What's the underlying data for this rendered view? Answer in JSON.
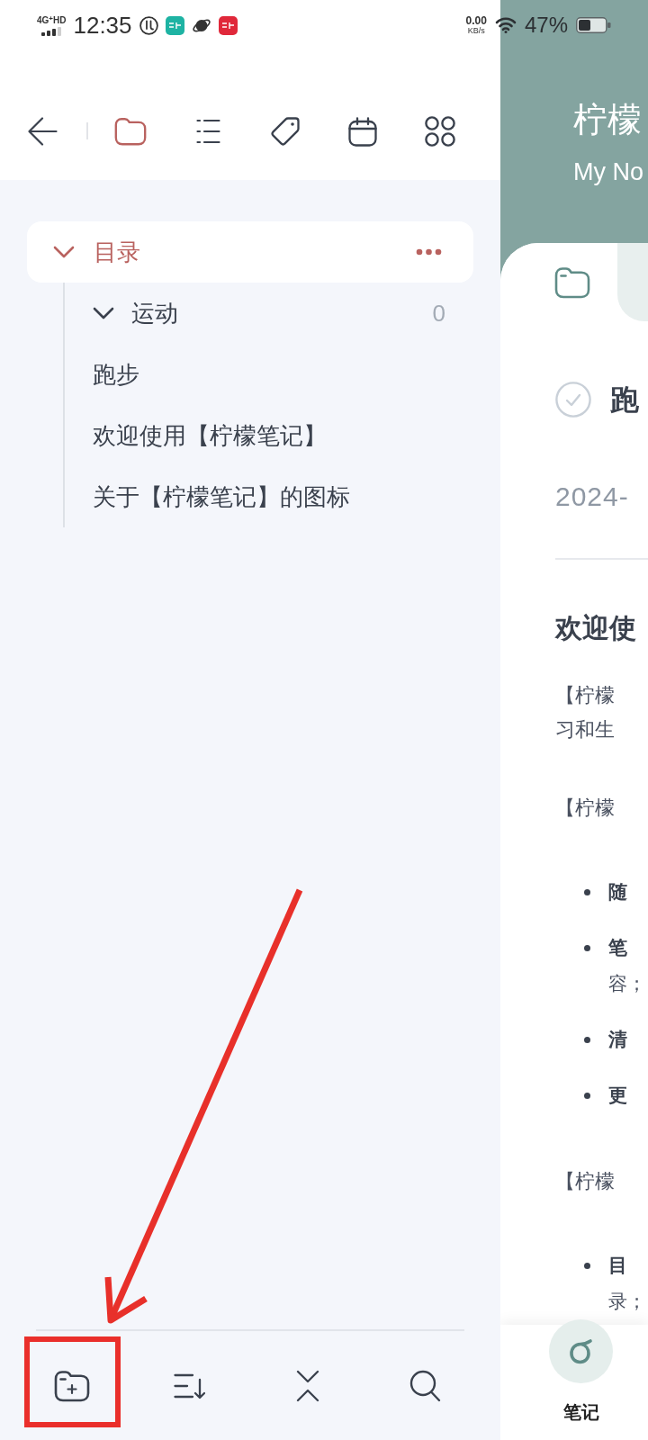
{
  "status_bar": {
    "network": "4G$^{+}$HD",
    "time": "12:35",
    "speed": "0.00",
    "speed_unit": "KB/s",
    "battery": "47%"
  },
  "toolbar": {
    "tabs": [
      {
        "selected": true
      },
      {
        "selected": false
      },
      {
        "selected": false
      },
      {
        "selected": false
      },
      {
        "selected": false
      }
    ]
  },
  "tree": {
    "label": "目录",
    "selected": true,
    "expanded": true,
    "children": [
      {
        "kind": "folder",
        "label": "运动",
        "count": "0",
        "selected": false,
        "expanded": true
      },
      {
        "kind": "note",
        "label": "跑步",
        "selected": false
      },
      {
        "kind": "note",
        "label": "欢迎使用【柠檬笔记】",
        "selected": false
      },
      {
        "kind": "note",
        "label": "关于【柠檬笔记】的图标",
        "selected": false
      }
    ]
  },
  "note_panel": {
    "title": "柠檬",
    "subtitle": "My No",
    "tabs": [
      {
        "selected": true
      },
      {
        "selected": false
      }
    ],
    "note": {
      "done": false,
      "title": "跑",
      "date": "2024-",
      "heading": "欢迎使",
      "blocks": [
        {
          "kind": "paragraph",
          "lines": [
            "【柠檬",
            "习和生"
          ]
        },
        {
          "kind": "paragraph",
          "lines": [
            "【柠檬"
          ]
        },
        {
          "kind": "bullets",
          "items": [
            {
              "term": "随"
            },
            {
              "term": "笔",
              "rest": "容；"
            },
            {
              "term": "清"
            },
            {
              "term": "更"
            }
          ]
        },
        {
          "kind": "paragraph",
          "lines": [
            "【柠檬"
          ]
        },
        {
          "kind": "bullets",
          "items": [
            {
              "term": "目",
              "rest": "录；"
            }
          ]
        }
      ]
    },
    "nav": [
      {
        "label": "笔记",
        "selected": true
      }
    ]
  }
}
